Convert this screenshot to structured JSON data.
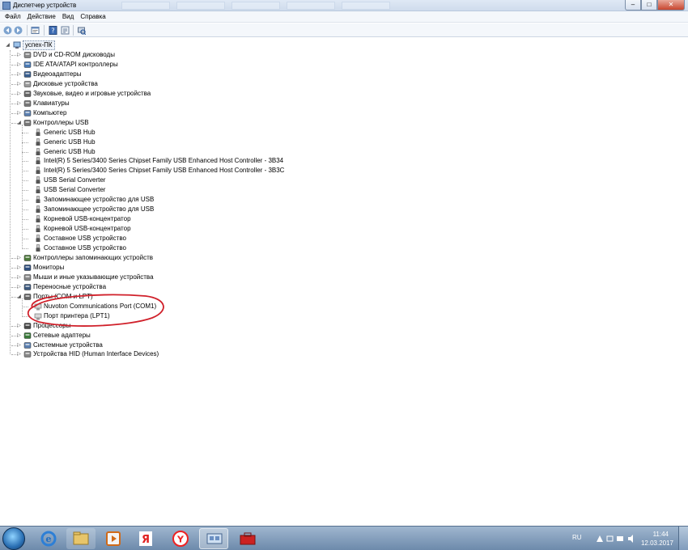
{
  "window": {
    "title": "Диспетчер устройств"
  },
  "menu": {
    "items": [
      "Файл",
      "Действие",
      "Вид",
      "Справка"
    ]
  },
  "toolbar": {
    "buttons": [
      "back-icon",
      "forward-icon",
      "properties-icon",
      "help-icon",
      "scan-hardware-icon"
    ]
  },
  "tree": {
    "root": "успех-ПК",
    "categories": {
      "dvd": "DVD и CD-ROM дисководы",
      "ide": "IDE ATA/ATAPI контроллеры",
      "video": "Видеоадаптеры",
      "disk": "Дисковые устройства",
      "sound": "Звуковые, видео и игровые устройства",
      "keyboard": "Клавиатуры",
      "computer": "Компьютер",
      "usb": "Контроллеры USB",
      "storage": "Контроллеры запоминающих устройств",
      "monitors": "Мониторы",
      "mice": "Мыши и иные указывающие устройства",
      "portable": "Переносные устройства",
      "ports": "Порты (COM и LPT)",
      "cpu": "Процессоры",
      "network": "Сетевые адаптеры",
      "system": "Системные устройства",
      "hid": "Устройства HID (Human Interface Devices)"
    },
    "usb_devices": [
      "Generic USB Hub",
      "Generic USB Hub",
      "Generic USB Hub",
      "Intel(R) 5 Series/3400 Series Chipset Family USB Enhanced Host Controller - 3B34",
      "Intel(R) 5 Series/3400 Series Chipset Family USB Enhanced Host Controller - 3B3C",
      "USB Serial Converter",
      "USB Serial Converter",
      "Запоминающее устройство для USB",
      "Запоминающее устройство для USB",
      "Корневой USB-концентратор",
      "Корневой USB-концентратор",
      "Составное USB устройство",
      "Составное USB устройство"
    ],
    "port_devices": [
      "Nuvoton Communications Port (COM1)",
      "Порт принтера (LPT1)"
    ]
  },
  "annotation": {
    "color": "#d0202a"
  },
  "taskbar": {
    "apps": [
      "ie-icon",
      "explorer-icon",
      "media-player-icon",
      "yandex-icon",
      "yandex-browser-icon",
      "device-manager-icon",
      "toolbox-icon"
    ],
    "tray": {
      "lang": "RU",
      "time": "11:44",
      "date": "12.03.2017"
    }
  }
}
